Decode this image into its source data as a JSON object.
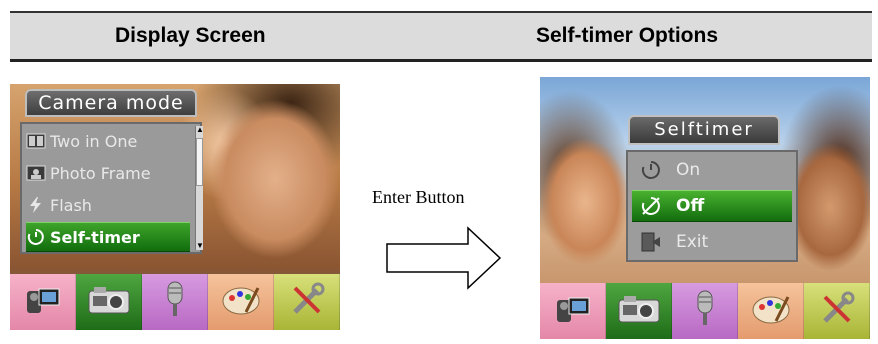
{
  "header": {
    "left_title": "Display Screen",
    "right_title": "Self-timer Options"
  },
  "left_screen": {
    "menu_title": "Camera mode",
    "items": [
      {
        "label": "Two in One",
        "icon": "two-in-one-icon",
        "selected": false
      },
      {
        "label": "Photo Frame",
        "icon": "photo-frame-icon",
        "selected": false
      },
      {
        "label": "Flash",
        "icon": "flash-icon",
        "selected": false
      },
      {
        "label": "Self-timer",
        "icon": "self-timer-icon",
        "selected": true
      }
    ]
  },
  "center": {
    "label": "Enter Button",
    "icon": "right-arrow-icon"
  },
  "right_screen": {
    "dialog_title": "Selftimer",
    "items": [
      {
        "label": "On",
        "icon": "timer-on-icon",
        "selected": false
      },
      {
        "label": "Off",
        "icon": "timer-off-icon",
        "selected": true
      },
      {
        "label": "Exit",
        "icon": "exit-door-icon",
        "selected": false
      }
    ]
  },
  "icon_bar": [
    {
      "name": "video-mode",
      "icon": "video-camera-icon",
      "color": "#e98fae",
      "selected": false
    },
    {
      "name": "camera-mode",
      "icon": "camera-icon",
      "color": "#2f8a26",
      "selected": true
    },
    {
      "name": "audio-mode",
      "icon": "microphone-icon",
      "color": "#c27bcc",
      "selected": false
    },
    {
      "name": "playback-mode",
      "icon": "palette-icon",
      "color": "#eaa67a",
      "selected": false
    },
    {
      "name": "setup-mode",
      "icon": "tools-icon",
      "color": "#b9c44a",
      "selected": false
    }
  ],
  "colors": {
    "selection_green": "#2f8a26",
    "menu_gray": "#9a9a9a",
    "header_bg": "#dcdcdc"
  }
}
